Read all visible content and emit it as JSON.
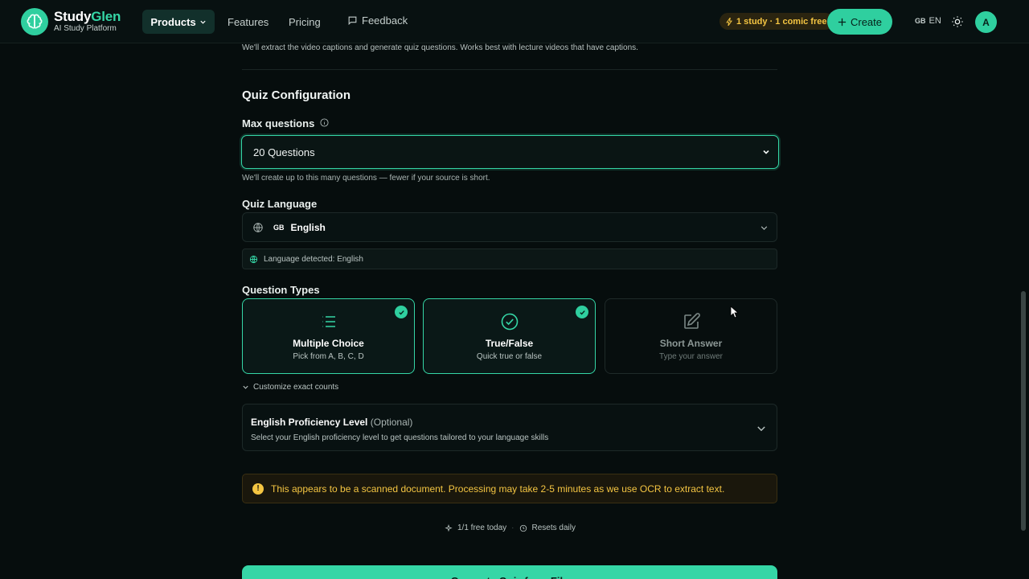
{
  "nav": {
    "brand_study": "Study",
    "brand_glen": "Glen",
    "brand_sub": "AI Study Platform",
    "products": "Products",
    "features": "Features",
    "pricing": "Pricing",
    "feedback": "Feedback",
    "free_pill": "1 study · 1 comic free",
    "create": "Create",
    "lang_flag": "GB",
    "lang_code": "EN",
    "avatar": "A"
  },
  "source_hint": "We'll extract the video captions and generate quiz questions. Works best with lecture videos that have captions.",
  "config": {
    "title": "Quiz Configuration",
    "max_label": "Max questions",
    "max_value": "20 Questions",
    "max_hint": "We'll create up to this many questions — fewer if your source is short.",
    "lang_label": "Quiz Language",
    "lang_flag": "GB",
    "lang_value": "English",
    "lang_detected": "Language detected: English",
    "types_label": "Question Types",
    "types": [
      {
        "title": "Multiple Choice",
        "desc": "Pick from A, B, C, D",
        "selected": true,
        "icon": "list-icon"
      },
      {
        "title": "True/False",
        "desc": "Quick true or false",
        "selected": true,
        "icon": "check-circle-icon"
      },
      {
        "title": "Short Answer",
        "desc": "Type your answer",
        "selected": false,
        "icon": "pencil-icon"
      }
    ],
    "customize": "Customize exact counts",
    "proficiency_title": "English Proficiency Level",
    "proficiency_optional": "(Optional)",
    "proficiency_desc": "Select your English proficiency level to get questions tailored to your language skills"
  },
  "warning": "This appears to be a scanned document. Processing may take 2-5 minutes as we use OCR to extract text.",
  "quota": {
    "free": "1/1 free today",
    "resets": "Resets daily"
  },
  "generate": "Generate Quiz from File",
  "colors": {
    "accent": "#2fcf9f",
    "background": "#060d0d",
    "warning": "#f4c542"
  }
}
